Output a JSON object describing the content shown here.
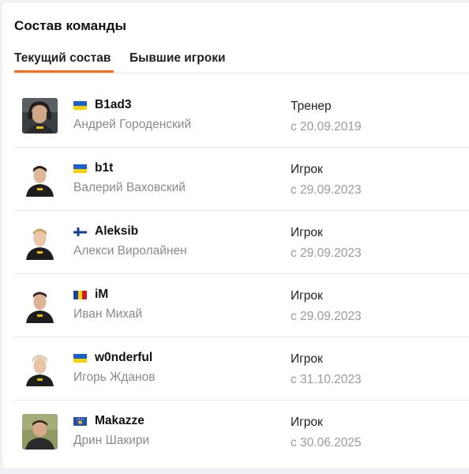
{
  "card": {
    "title": "Состав команды"
  },
  "tabs": [
    {
      "label": "Текущий состав",
      "active": true
    },
    {
      "label": "Бывшие игроки",
      "active": false
    }
  ],
  "accent_color": "#ff6a1a",
  "players": [
    {
      "nickname": "B1ad3",
      "name": "Андрей Городенский",
      "role": "Тренер",
      "since": "с 20.09.2019",
      "flag": "ukraine-flag-icon"
    },
    {
      "nickname": "b1t",
      "name": "Валерий Ваховский",
      "role": "Игрок",
      "since": "с 29.09.2023",
      "flag": "ukraine-flag-icon"
    },
    {
      "nickname": "Aleksib",
      "name": "Алекси Виролайнен",
      "role": "Игрок",
      "since": "с 29.09.2023",
      "flag": "finland-flag-icon"
    },
    {
      "nickname": "iM",
      "name": "Иван Михай",
      "role": "Игрок",
      "since": "с 29.09.2023",
      "flag": "romania-flag-icon"
    },
    {
      "nickname": "w0nderful",
      "name": "Игорь Жданов",
      "role": "Игрок",
      "since": "с 31.10.2023",
      "flag": "ukraine-flag-icon"
    },
    {
      "nickname": "Makazze",
      "name": "Дрин Шакири",
      "role": "Игрок",
      "since": "с 30.06.2025",
      "flag": "kosovo-flag-icon"
    }
  ]
}
